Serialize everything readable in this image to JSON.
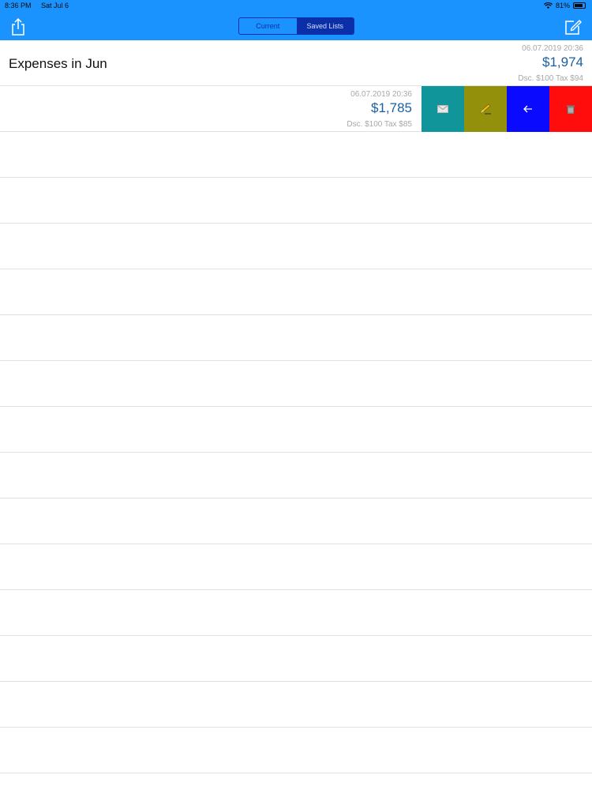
{
  "status_bar": {
    "time": "8:36 PM",
    "date": "Sat Jul 6",
    "battery": "81%"
  },
  "header": {
    "segments": [
      "Current",
      "Saved Lists"
    ],
    "selected_segment": "Saved Lists"
  },
  "lists": [
    {
      "title": "Expenses in Jun",
      "date": "06.07.2019 20:36",
      "amount": "$1,974",
      "meta": "Dsc. $100 Tax $94"
    },
    {
      "title": "",
      "date": "06.07.2019 20:36",
      "amount": "$1,785",
      "meta": "Dsc. $100 Tax $85"
    }
  ],
  "swipe_actions": [
    {
      "name": "mail",
      "icon": "envelope-icon",
      "color": "#10969a"
    },
    {
      "name": "edit",
      "icon": "pencil-icon",
      "color": "#93910c"
    },
    {
      "name": "move",
      "icon": "arrow-left-icon",
      "color": "#0a0aff"
    },
    {
      "name": "delete",
      "icon": "trash-icon",
      "color": "#ff0d0d"
    }
  ],
  "colors": {
    "header": "#1a93ff",
    "segment_selected": "#0b2fa8",
    "amount": "#1b5fa0"
  }
}
